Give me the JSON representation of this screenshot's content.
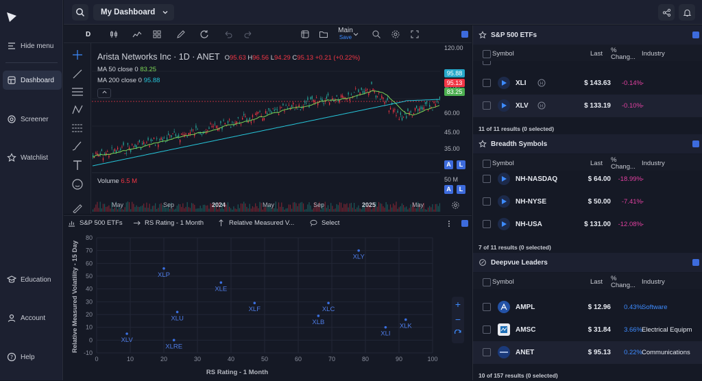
{
  "nav": {
    "hide_menu": "Hide menu",
    "items": [
      {
        "label": "Dashboard"
      },
      {
        "label": "Screener"
      },
      {
        "label": "Watchlist"
      },
      {
        "label": "Education"
      },
      {
        "label": "Account"
      },
      {
        "label": "Help"
      }
    ]
  },
  "topbar": {
    "dashboard_name": "My Dashboard"
  },
  "chart": {
    "interval": "D",
    "layout_label": "Main",
    "layout_sub": "Save",
    "title": "Arista Networks Inc · 1D · ANET",
    "o_label": "O",
    "o": "95.63",
    "h_label": "H",
    "h": "96.56",
    "l_label": "L",
    "l": "94.29",
    "c_label": "C",
    "c": "95.13",
    "change": "+0.21 (+0.22%)",
    "ma50_label": "MA 50 close 0",
    "ma50": "83.25",
    "ma200_label": "MA 200 close 0",
    "ma200": "95.88",
    "volume_label": "Volume",
    "volume": "6.5 M",
    "price_ticks": [
      "120.00",
      "90.00",
      "60.00",
      "45.00",
      "35.00"
    ],
    "volume_tick": "50 M",
    "price_tags": {
      "ma200": "95.88",
      "last": "95.13",
      "ma50": "83.25"
    },
    "time_ticks": [
      "May",
      "Sep",
      "2024",
      "May",
      "Sep",
      "2025",
      "May"
    ],
    "auto_label": "A",
    "log_label": "L",
    "colors": {
      "up": "#26a69a",
      "down": "#f23645",
      "ma50": "#7ed957",
      "ma200": "#26c6da"
    }
  },
  "scatter": {
    "toolbar": {
      "list": "S&P 500 ETFs",
      "x_metric": "RS Rating - 1 Month",
      "y_metric": "Relative Measured V...",
      "select": "Select"
    },
    "chart_data": {
      "type": "scatter",
      "xlabel": "RS Rating - 1 Month",
      "ylabel": "Relative Measured Volatility - 15 Day",
      "xlim": [
        0,
        100
      ],
      "ylim": [
        -10,
        80
      ],
      "x_ticks": [
        "0",
        "10",
        "20",
        "30",
        "40",
        "50",
        "60",
        "70",
        "80",
        "90",
        "100"
      ],
      "y_ticks": [
        "80",
        "70",
        "60",
        "50",
        "40",
        "30",
        "20",
        "10",
        "0",
        "-10"
      ],
      "points": [
        {
          "label": "XLV",
          "x": 9,
          "y": 5
        },
        {
          "label": "XLP",
          "x": 20,
          "y": 56
        },
        {
          "label": "XLU",
          "x": 24,
          "y": 22
        },
        {
          "label": "XLRE",
          "x": 23,
          "y": 0
        },
        {
          "label": "XLE",
          "x": 37,
          "y": 45
        },
        {
          "label": "XLF",
          "x": 47,
          "y": 29
        },
        {
          "label": "XLB",
          "x": 66,
          "y": 19
        },
        {
          "label": "XLC",
          "x": 69,
          "y": 29
        },
        {
          "label": "XLY",
          "x": 78,
          "y": 70
        },
        {
          "label": "XLI",
          "x": 86,
          "y": 10
        },
        {
          "label": "XLK",
          "x": 92,
          "y": 16
        }
      ]
    }
  },
  "etfs": {
    "title": "S&P 500 ETFs",
    "cols": {
      "symbol": "Symbol",
      "last": "Last",
      "chg1": "%",
      "chg2": "Chang...",
      "industry": "Industry"
    },
    "rows": [
      {
        "symbol": "XLI",
        "last": "$ 143.63",
        "chg": "-0.14%",
        "industry": "-"
      },
      {
        "symbol": "XLV",
        "last": "$ 133.19",
        "chg": "-0.10%",
        "industry": "-"
      }
    ],
    "footer": "11 of 11 results (0 selected)"
  },
  "breadth": {
    "title": "Breadth Symbols",
    "cols": {
      "symbol": "Symbol",
      "last": "Last",
      "chg1": "%",
      "chg2": "Chang...",
      "industry": "Industry"
    },
    "rows": [
      {
        "symbol": "NH-NASDAQ",
        "last": "$ 64.00",
        "chg": "-18.99%",
        "industry": "-"
      },
      {
        "symbol": "NH-NYSE",
        "last": "$ 50.00",
        "chg": "-7.41%",
        "industry": "-"
      },
      {
        "symbol": "NH-USA",
        "last": "$ 131.00",
        "chg": "-12.08%",
        "industry": "-"
      }
    ],
    "footer": "7 of 11 results (0 selected)"
  },
  "leaders": {
    "title": "Deepvue Leaders",
    "cols": {
      "symbol": "Symbol",
      "last": "Last",
      "chg1": "%",
      "chg2": "Chang...",
      "industry": "Industry"
    },
    "rows": [
      {
        "symbol": "AMPL",
        "last": "$ 12.96",
        "chg": "0.43%",
        "industry": "Software"
      },
      {
        "symbol": "AMSC",
        "last": "$ 31.84",
        "chg": "3.66%",
        "industry": "Electrical Equipm"
      },
      {
        "symbol": "ANET",
        "last": "$ 95.13",
        "chg": "0.22%",
        "industry": "Communications"
      }
    ],
    "footer": "10 of 157 results (0 selected)"
  },
  "colors": {
    "accent": "#3d6bdc",
    "negative": "#e040a0",
    "positive": "#3d8bff"
  }
}
